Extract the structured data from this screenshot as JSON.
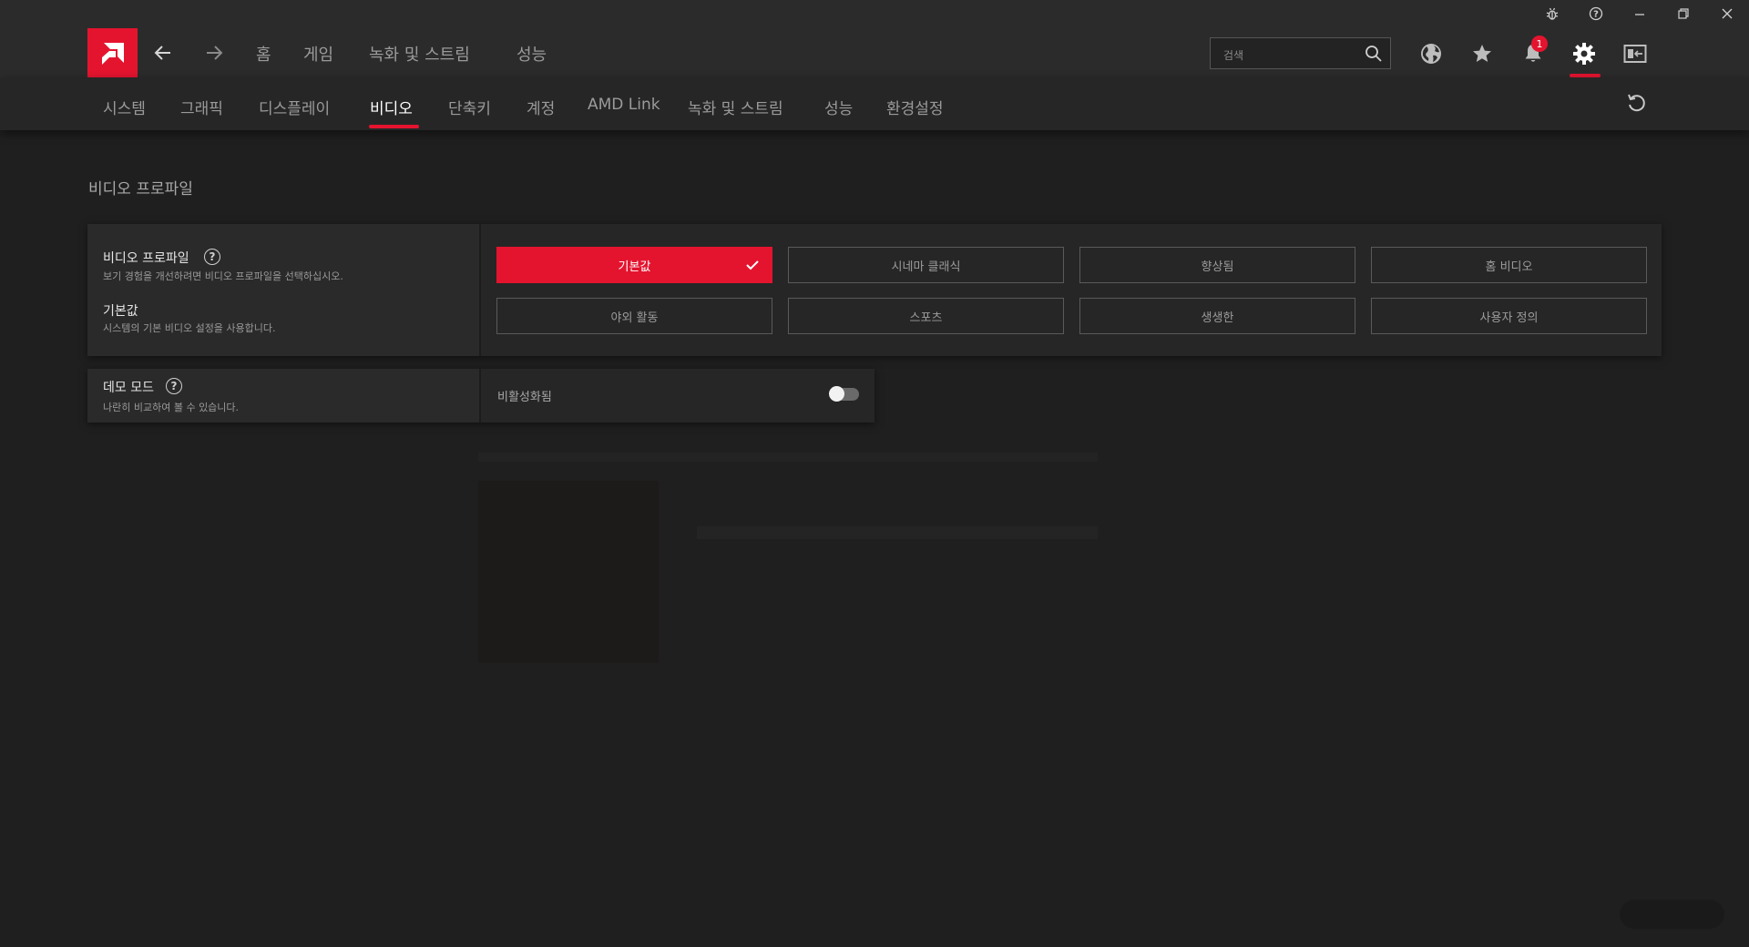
{
  "titlebar": {
    "icons": [
      "bug-icon",
      "help-icon",
      "minimize-icon",
      "restore-icon",
      "close-icon"
    ]
  },
  "topnav": {
    "links": [
      "홈",
      "게임",
      "녹화 및 스트림",
      "성능"
    ],
    "search_placeholder": "검색",
    "notification_count": "1",
    "icons": [
      "globe-icon",
      "star-icon",
      "bell-icon",
      "gear-icon",
      "sidebar-panel-icon"
    ]
  },
  "subnav": {
    "tabs": [
      "시스템",
      "그래픽",
      "디스플레이",
      "비디오",
      "단축키",
      "계정",
      "AMD Link",
      "녹화 및 스트림",
      "성능",
      "환경설정"
    ],
    "active_tab": "비디오"
  },
  "content": {
    "section_title": "비디오 프로파일",
    "video_profile": {
      "title": "비디오 프로파일",
      "description": "보기 경험을 개선하려면 비디오 프로파일을 선택하십시오.",
      "current_title": "기본값",
      "current_description": "시스템의 기본 비디오 설정을 사용합니다.",
      "options": [
        "기본값",
        "시네마 클래식",
        "향상됨",
        "홈 비디오",
        "야외 활동",
        "스포츠",
        "생생한",
        "사용자 정의"
      ],
      "selected": "기본값"
    },
    "demo_mode": {
      "title": "데모 모드",
      "description": "나란히 비교하여 볼 수 있습니다.",
      "status": "비활성화됨",
      "enabled": false
    }
  },
  "colors": {
    "accent": "#e4142f",
    "background": "#1f1f1f",
    "bar": "#2b2b2b"
  }
}
